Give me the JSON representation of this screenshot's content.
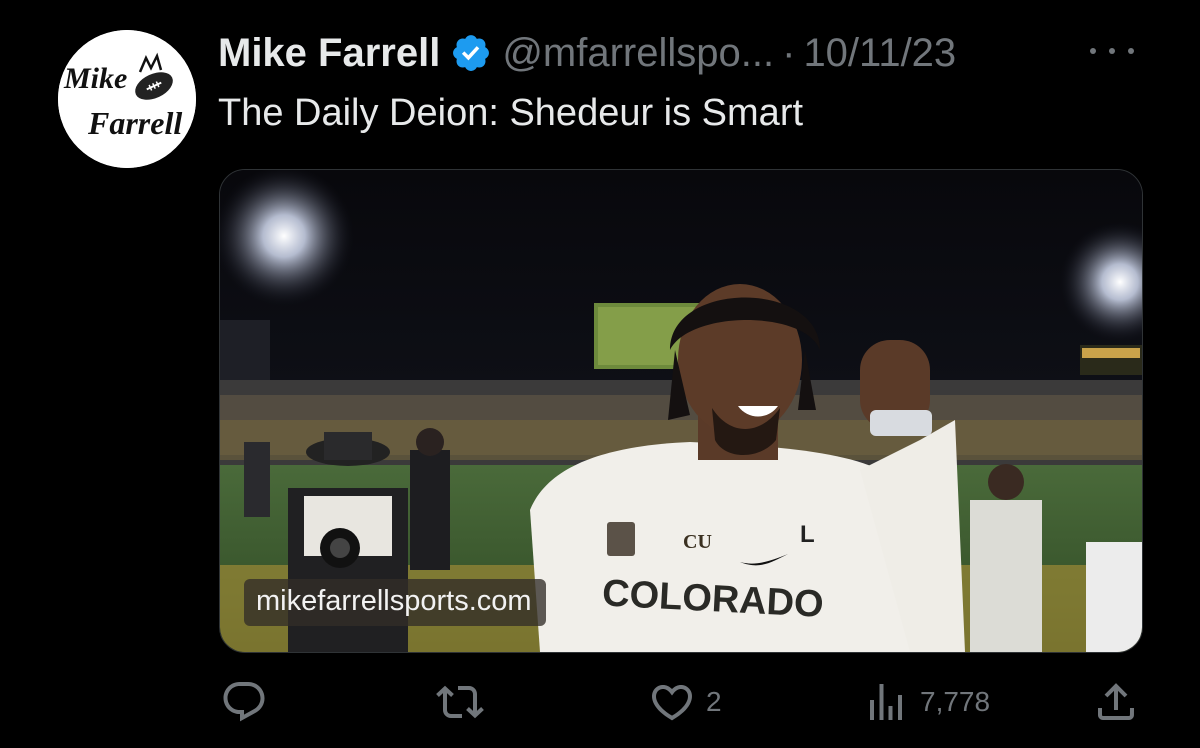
{
  "tweet": {
    "author": {
      "display_name": "Mike Farrell",
      "handle": "@mfarrellspo...",
      "verified": true,
      "avatar_text_line1": "Mike",
      "avatar_text_line2": "Farrell"
    },
    "separator": "·",
    "date": "10/11/23",
    "text": "The Daily Deion: Shedeur is Smart",
    "media": {
      "watermark": "mikefarrellsports.com",
      "jersey_text": "COLORADO",
      "jersey_letter": "L",
      "jersey_logo": "CU"
    },
    "actions": {
      "reply_count": "",
      "retweet_count": "",
      "like_count": "2",
      "views_count": "7,778"
    }
  },
  "colors": {
    "background": "#000000",
    "primary_text": "#e7e9ea",
    "secondary_text": "#71767b",
    "verified": "#1d9bf0"
  }
}
